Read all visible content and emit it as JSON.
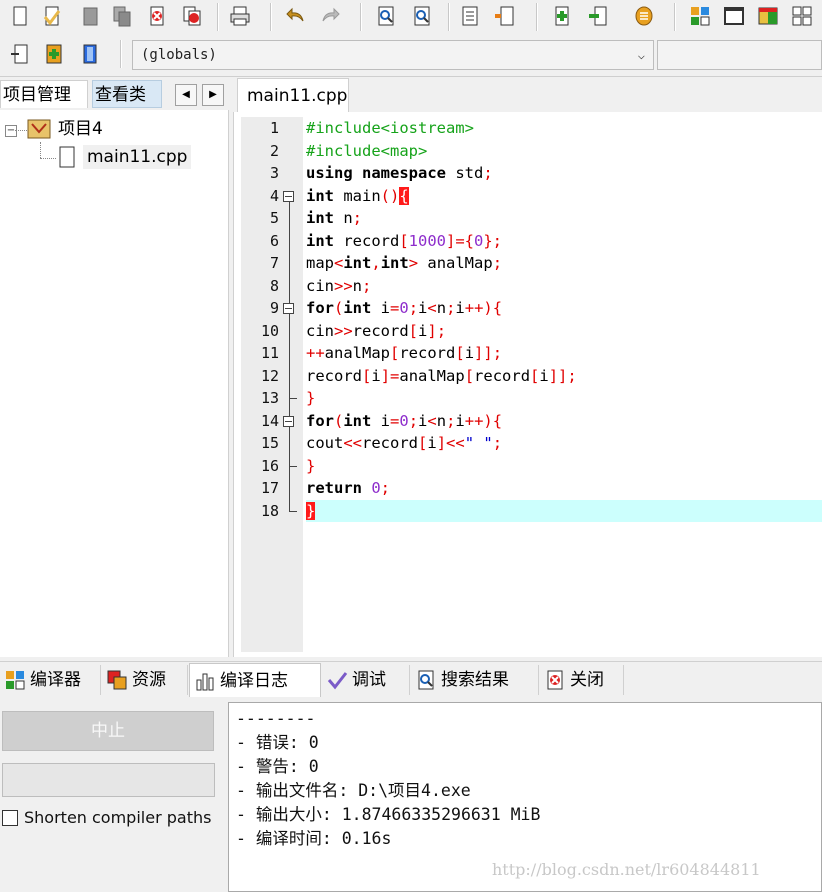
{
  "globals_combo": {
    "value": "(globals)"
  },
  "left_tabs": [
    "项目管理",
    "查看类"
  ],
  "tree": {
    "project": "项目4",
    "file": "main11.cpp"
  },
  "editor": {
    "tab": "main11.cpp",
    "line_numbers": [
      "1",
      "2",
      "3",
      "4",
      "5",
      "6",
      "7",
      "8",
      "9",
      "10",
      "11",
      "12",
      "13",
      "14",
      "15",
      "16",
      "17",
      "18"
    ],
    "lines": [
      [
        [
          "pp",
          "#include<iostream>"
        ]
      ],
      [
        [
          "pp",
          "#include<map>"
        ]
      ],
      [
        [
          "kw",
          "using namespace "
        ],
        [
          "",
          "std"
        ],
        [
          "sy",
          ";"
        ]
      ],
      [
        [
          "kw",
          "int "
        ],
        [
          "",
          "main"
        ],
        [
          "sy",
          "()"
        ],
        [
          "brk",
          "{"
        ]
      ],
      [
        [
          "kw",
          "int "
        ],
        [
          "",
          "n"
        ],
        [
          "sy",
          ";"
        ]
      ],
      [
        [
          "kw",
          "int "
        ],
        [
          "",
          "record"
        ],
        [
          "sy",
          "["
        ],
        [
          "nm",
          "1000"
        ],
        [
          "sy",
          "]={"
        ],
        [
          "nm",
          "0"
        ],
        [
          "sy",
          "};"
        ]
      ],
      [
        [
          "",
          "map"
        ],
        [
          "sy",
          "<"
        ],
        [
          "kw",
          "int"
        ],
        [
          "sy",
          ","
        ],
        [
          "kw",
          "int"
        ],
        [
          "sy",
          "> "
        ],
        [
          "",
          "analMap"
        ],
        [
          "sy",
          ";"
        ]
      ],
      [
        [
          "",
          "cin"
        ],
        [
          "sy",
          ">>"
        ],
        [
          "",
          "n"
        ],
        [
          "sy",
          ";"
        ]
      ],
      [
        [
          "kw",
          "for"
        ],
        [
          "sy",
          "("
        ],
        [
          "kw",
          "int "
        ],
        [
          "",
          "i"
        ],
        [
          "sy",
          "="
        ],
        [
          "nm",
          "0"
        ],
        [
          "sy",
          ";"
        ],
        [
          "",
          "i"
        ],
        [
          "sy",
          "<"
        ],
        [
          "",
          "n"
        ],
        [
          "sy",
          ";"
        ],
        [
          "",
          "i"
        ],
        [
          "sy",
          "++){"
        ]
      ],
      [
        [
          "",
          "cin"
        ],
        [
          "sy",
          ">>"
        ],
        [
          "",
          "record"
        ],
        [
          "sy",
          "["
        ],
        [
          "",
          "i"
        ],
        [
          "sy",
          "];"
        ]
      ],
      [
        [
          "sy",
          "++"
        ],
        [
          "",
          "analMap"
        ],
        [
          "sy",
          "["
        ],
        [
          "",
          "record"
        ],
        [
          "sy",
          "["
        ],
        [
          "",
          "i"
        ],
        [
          "sy",
          "]];"
        ]
      ],
      [
        [
          "",
          "record"
        ],
        [
          "sy",
          "["
        ],
        [
          "",
          "i"
        ],
        [
          "sy",
          "]="
        ],
        [
          "",
          "analMap"
        ],
        [
          "sy",
          "["
        ],
        [
          "",
          "record"
        ],
        [
          "sy",
          "["
        ],
        [
          "",
          "i"
        ],
        [
          "sy",
          "]];"
        ]
      ],
      [
        [
          "sy",
          "}"
        ]
      ],
      [
        [
          "kw",
          "for"
        ],
        [
          "sy",
          "("
        ],
        [
          "kw",
          "int "
        ],
        [
          "",
          "i"
        ],
        [
          "sy",
          "="
        ],
        [
          "nm",
          "0"
        ],
        [
          "sy",
          ";"
        ],
        [
          "",
          "i"
        ],
        [
          "sy",
          "<"
        ],
        [
          "",
          "n"
        ],
        [
          "sy",
          ";"
        ],
        [
          "",
          "i"
        ],
        [
          "sy",
          "++){"
        ]
      ],
      [
        [
          "",
          "cout"
        ],
        [
          "sy",
          "<<"
        ],
        [
          "",
          "record"
        ],
        [
          "sy",
          "["
        ],
        [
          "",
          "i"
        ],
        [
          "sy",
          "]<<"
        ],
        [
          "st",
          "\" \""
        ],
        [
          "sy",
          ";"
        ]
      ],
      [
        [
          "sy",
          "}"
        ]
      ],
      [
        [
          "kw",
          "return "
        ],
        [
          "nm",
          "0"
        ],
        [
          "sy",
          ";"
        ]
      ],
      [
        [
          "brk",
          "}"
        ]
      ]
    ]
  },
  "bottom_tabs": [
    "编译器",
    "资源",
    "编译日志",
    "调试",
    "搜索结果",
    "关闭"
  ],
  "abort_button": "中止",
  "shorten_paths_label": "Shorten compiler paths",
  "log_lines": [
    "--------",
    "- 错误: 0",
    "- 警告: 0",
    "- 输出文件名: D:\\项目4.exe",
    "- 输出大小: 1.87466335296631 MiB",
    "- 编译时间: 0.16s"
  ],
  "watermark": "http://blog.csdn.net/lr604844811"
}
